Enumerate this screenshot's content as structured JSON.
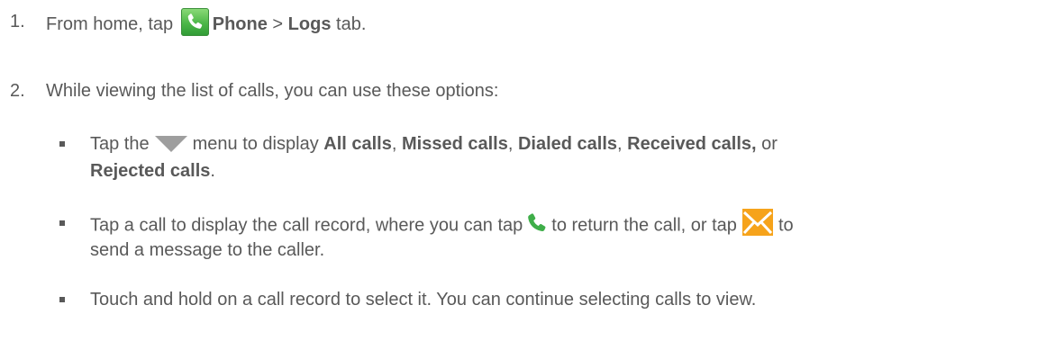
{
  "steps": [
    {
      "number": "1.",
      "prefix": "From home, tap",
      "phone": "Phone",
      "sep": ">",
      "logs": "Logs",
      "suffix": "tab."
    },
    {
      "number": "2.",
      "text": "While viewing the list of calls, you can use these options:"
    }
  ],
  "bullets": {
    "menu": {
      "a": "Tap the",
      "b": "menu to display",
      "all": "All calls",
      "c1": ",",
      "missed": "Missed calls",
      "c2": ",",
      "dialed": "Dialed calls",
      "c3": ",",
      "received": "Received calls,",
      "or": "or",
      "rejected": "Rejected calls",
      "end": "."
    },
    "record": {
      "a": "Tap a call to display the call record, where you can tap",
      "b": "to return the call, or tap",
      "c": "to",
      "line2": "send a message to the caller."
    },
    "hold": {
      "text": "Touch and hold on a call record to select it. You can continue selecting calls to view."
    }
  },
  "icons": {
    "phone_app": "phone-app-icon",
    "menu": "dropdown-triangle-icon",
    "call": "phone-handset-icon",
    "message": "envelope-icon"
  },
  "colors": {
    "text": "#595959",
    "phone_green": "#4cb748",
    "message_orange": "#f6a31b",
    "triangle_gray": "#9e9e9e"
  }
}
